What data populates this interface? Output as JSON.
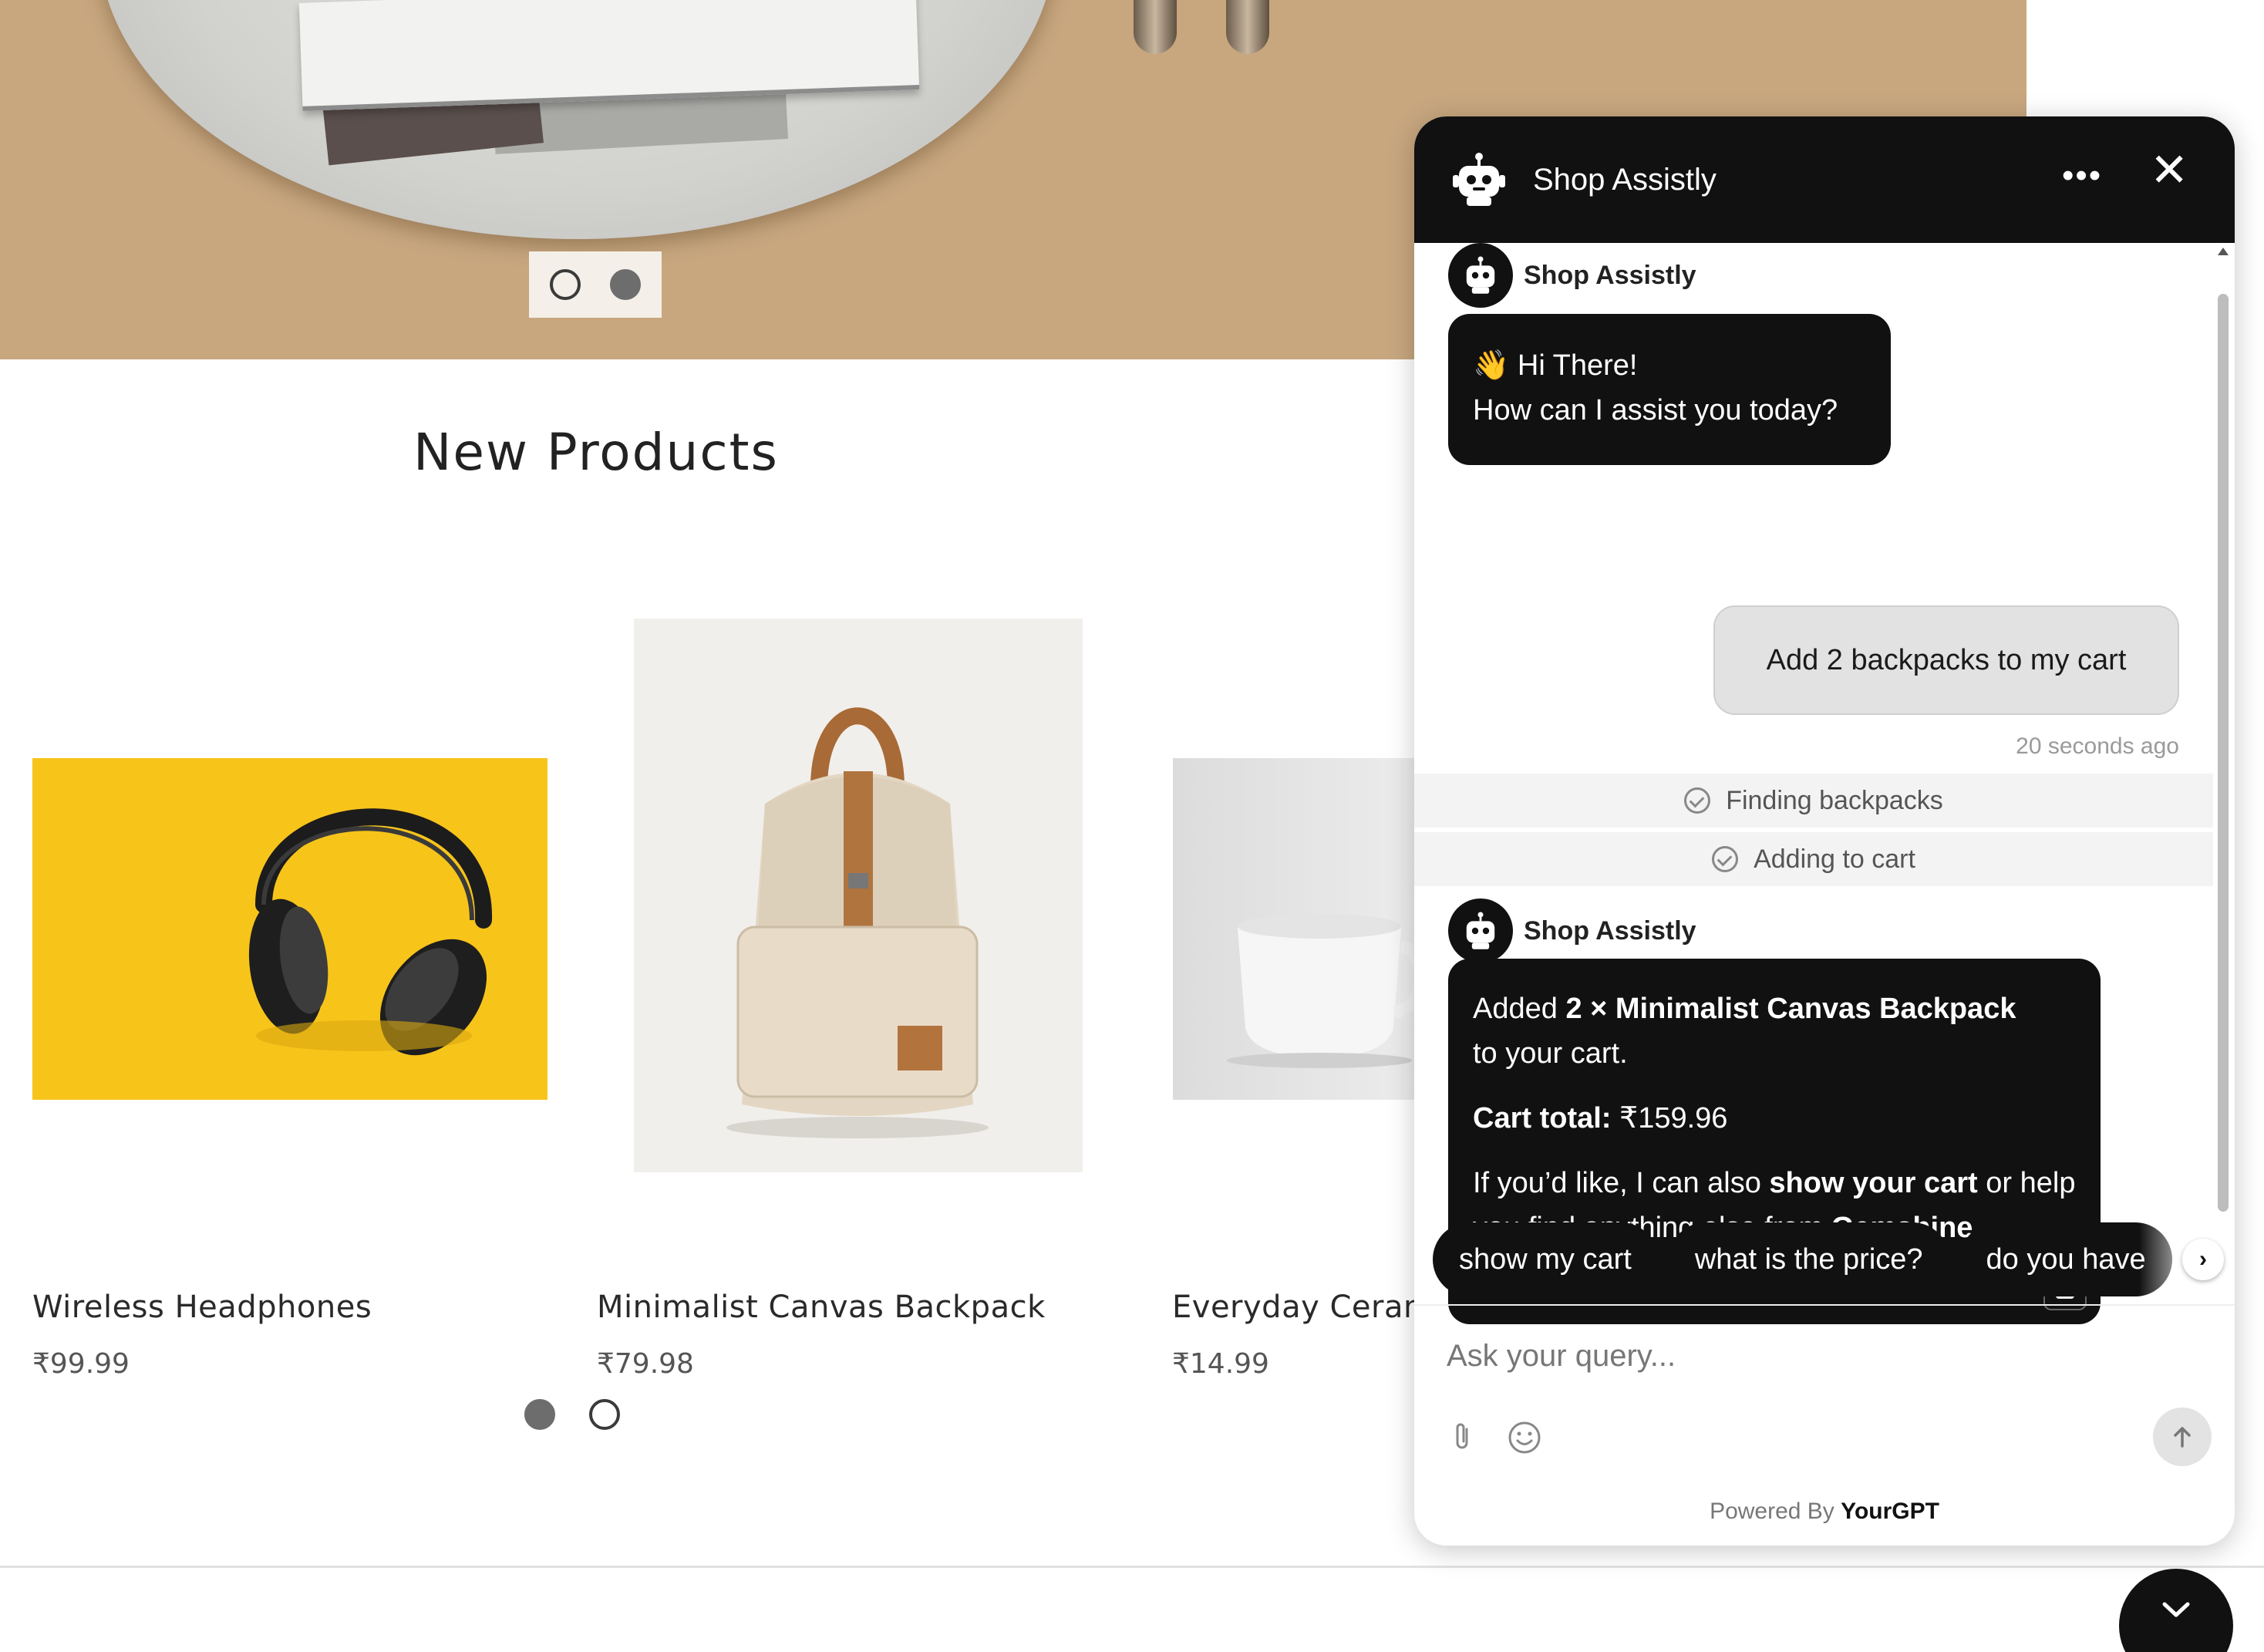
{
  "hero": {
    "active_slide": 2,
    "slide_count": 2
  },
  "section": {
    "title": "New Products"
  },
  "products": [
    {
      "name": "Wireless Headphones",
      "price": "₹99.99"
    },
    {
      "name": "Minimalist Canvas Backpack",
      "price": "₹79.98"
    },
    {
      "name": "Everyday Ceram",
      "price": "₹14.99"
    }
  ],
  "product_carousel": {
    "active_page": 1,
    "page_count": 2
  },
  "chat": {
    "title": "Shop Assistly",
    "more_icon": "more-horizontal-icon",
    "close_icon": "close-icon",
    "bot_name": "Shop Assistly",
    "greeting": {
      "emoji": "👋",
      "line1": "Hi There!",
      "line2": "How can I assist you today?"
    },
    "user_message": "Add 2 backpacks to my cart",
    "timestamp": "20 seconds ago",
    "tool_steps": [
      "Finding backpacks",
      "Adding to cart"
    ],
    "reply": {
      "added_prefix": "Added ",
      "added_item": "2 × Minimalist Canvas Backpack",
      "added_suffix": "to your cart.",
      "cart_total_label": "Cart total:",
      "cart_total_value": " ₹159.96",
      "offer_prefix": "If you’d like, I can also ",
      "offer_bold": "show your cart",
      "offer_middle": " or help you find anything else from ",
      "offer_store": "Gemshine",
      "offer_end": "."
    },
    "suggestions": [
      "show my cart",
      "what is the price?",
      "do you have"
    ],
    "input_placeholder": "Ask your query...",
    "powered_by_prefix": "Powered By",
    "powered_by_brand": "YourGPT"
  },
  "colors": {
    "chat_dark": "#111111",
    "hero_bg": "#c8a77f",
    "headphones_bg": "#f7c41a"
  }
}
